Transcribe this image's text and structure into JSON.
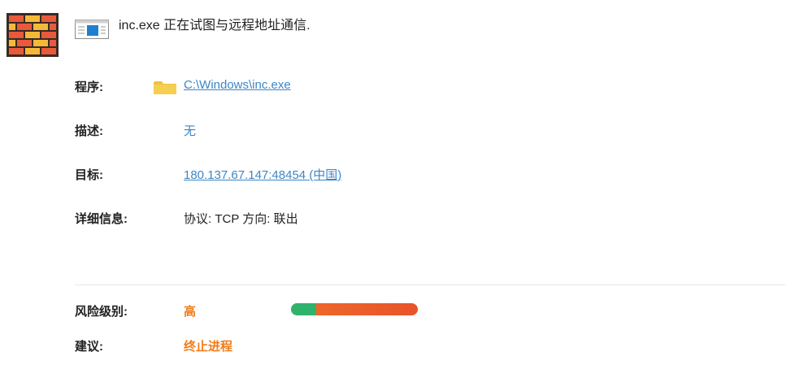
{
  "alert": {
    "title": "inc.exe 正在试图与远程地址通信."
  },
  "icons": {
    "header": "firewall-brick-icon",
    "app": "application-window-icon",
    "folder": "folder-icon"
  },
  "rows": {
    "program": {
      "label": "程序:",
      "value": "C:\\Windows\\inc.exe"
    },
    "description": {
      "label": "描述:",
      "value": "无"
    },
    "target": {
      "label": "目标:",
      "value": "180.137.67.147:48454 (中国)"
    },
    "details": {
      "label": "详细信息:",
      "value": "协议: TCP 方向: 联出"
    }
  },
  "risk": {
    "label": "风险级别:",
    "value": "高",
    "level_fraction": 0.8
  },
  "suggestion": {
    "label": "建议:",
    "value": "终止进程"
  },
  "colors": {
    "link": "#3d86c6",
    "warning": "#f07c1a",
    "bar_green": "#2fb36c",
    "bar_red": "#e8542a",
    "brick_red": "#e85a3c",
    "brick_yellow": "#f5b93a"
  }
}
